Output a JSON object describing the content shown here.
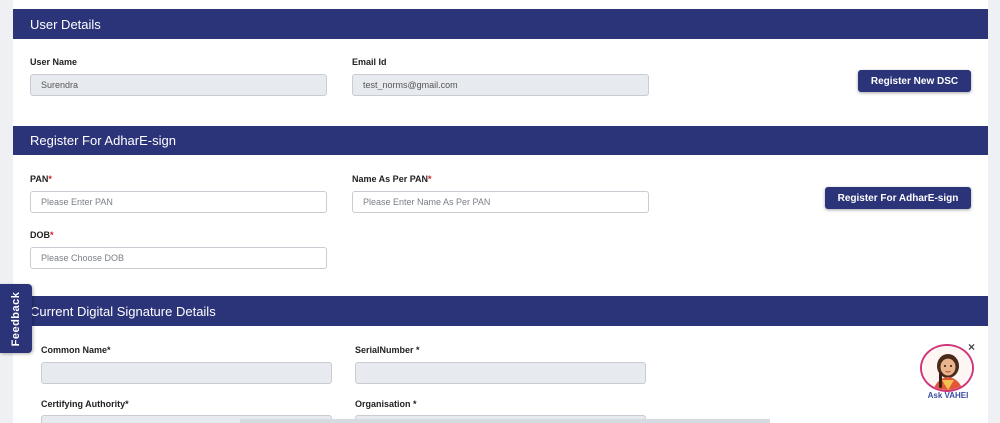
{
  "user_details": {
    "header": "User Details",
    "user_name_label": "User Name",
    "user_name_value": "Surendra",
    "email_label": "Email Id",
    "email_value": "test_norms@gmail.com",
    "register_dsc_button": "Register New DSC"
  },
  "adhar_esign": {
    "header": "Register For AdharE-sign",
    "pan_label": "PAN",
    "pan_placeholder": "Please Enter PAN",
    "name_label": "Name As Per PAN",
    "name_placeholder": "Please Enter Name As Per PAN",
    "dob_label": "DOB",
    "dob_placeholder": "Please Choose DOB",
    "required_mark": "*",
    "register_button": "Register For AdharE-sign"
  },
  "current_signature": {
    "header": "Current Digital Signature Details",
    "common_name_label": "Common Name*",
    "serial_number_label": "SerialNumber *",
    "certifying_authority_label": "Certifying Authority*",
    "organisation_label": "Organisation *"
  },
  "feedback": {
    "label": "Feedback"
  },
  "assistant": {
    "label": "Ask VAHEI",
    "close_icon": "×"
  },
  "colors": {
    "header_bg": "#2b3379",
    "button_bg": "#2b3379",
    "required": "#d21f1f",
    "assistant_border": "#d0357a"
  }
}
